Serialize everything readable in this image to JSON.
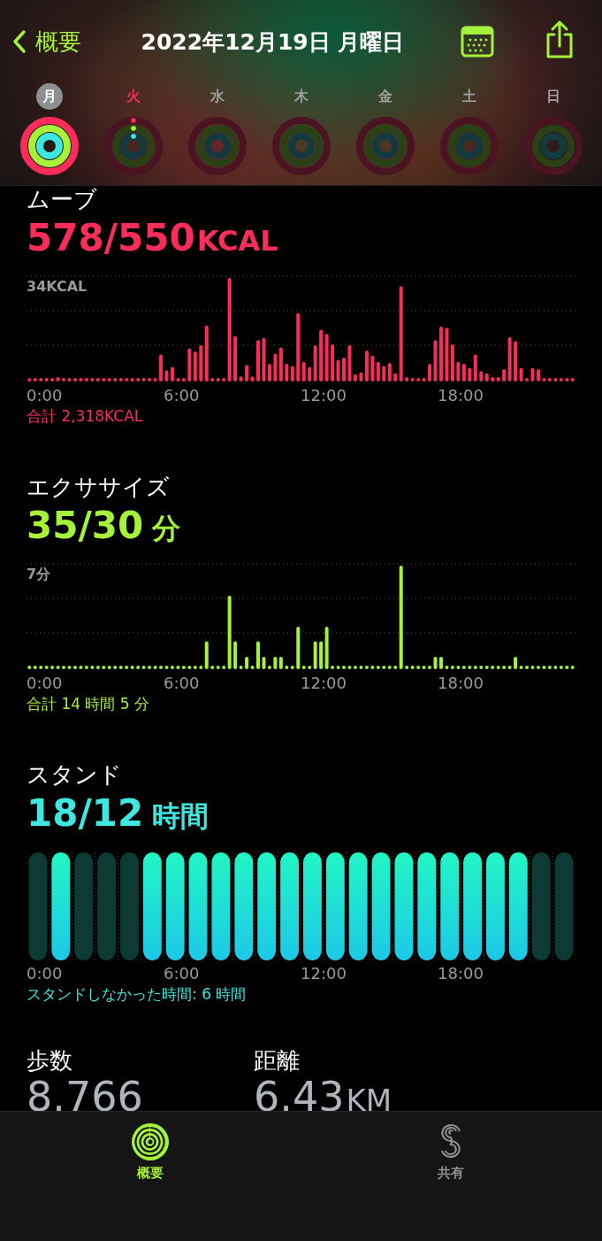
{
  "header": {
    "back_label": "概要",
    "title": "2022年12月19日 月曜日"
  },
  "days": [
    {
      "label": "月",
      "selected": true,
      "today": false,
      "kind": "closed"
    },
    {
      "label": "火",
      "selected": false,
      "today": true,
      "kind": "started"
    },
    {
      "label": "水",
      "selected": false,
      "today": false
    },
    {
      "label": "木",
      "selected": false,
      "today": false
    },
    {
      "label": "金",
      "selected": false,
      "today": false
    },
    {
      "label": "土",
      "selected": false,
      "today": false
    },
    {
      "label": "日",
      "selected": false,
      "today": false
    }
  ],
  "sections": [
    {
      "kind": "move",
      "title": "ムーブ",
      "value": "578/550",
      "unit": "KCAL",
      "scale_label": "34KCAL",
      "x_labels": [
        "0:00",
        "6:00",
        "12:00",
        "18:00"
      ],
      "summary": "合計 2,318KCAL"
    },
    {
      "kind": "exercise",
      "title": "エクササイズ",
      "value": "35/30",
      "unit": "分",
      "scale_label": "7分",
      "x_labels": [
        "0:00",
        "6:00",
        "12:00",
        "18:00"
      ],
      "summary": "合計 14 時間 5 分"
    },
    {
      "kind": "stand",
      "title": "スタンド",
      "value": "18/12",
      "unit": "時間",
      "x_labels": [
        "0:00",
        "6:00",
        "12:00",
        "18:00"
      ],
      "summary": "スタンドしなかった時間: 6 時間",
      "hours": [
        {
          "stood": false
        },
        {
          "stood": true
        },
        {
          "stood": false
        },
        {
          "stood": false
        },
        {
          "stood": false
        },
        {
          "stood": true
        },
        {
          "stood": true
        },
        {
          "stood": true
        },
        {
          "stood": true
        },
        {
          "stood": true
        },
        {
          "stood": true
        },
        {
          "stood": true
        },
        {
          "stood": true
        },
        {
          "stood": true
        },
        {
          "stood": true
        },
        {
          "stood": true
        },
        {
          "stood": true
        },
        {
          "stood": true
        },
        {
          "stood": true
        },
        {
          "stood": true
        },
        {
          "stood": true
        },
        {
          "stood": true
        },
        {
          "stood": false
        },
        {
          "stood": false
        }
      ]
    }
  ],
  "metrics": [
    {
      "label": "歩数",
      "value": "8.766"
    },
    {
      "label": "距離",
      "value": "6.43",
      "unit": "KM"
    }
  ],
  "tabs": [
    {
      "label": "概要",
      "kind": "summary",
      "selected": true
    },
    {
      "label": "共有",
      "kind": "sharing",
      "selected": false
    }
  ]
}
